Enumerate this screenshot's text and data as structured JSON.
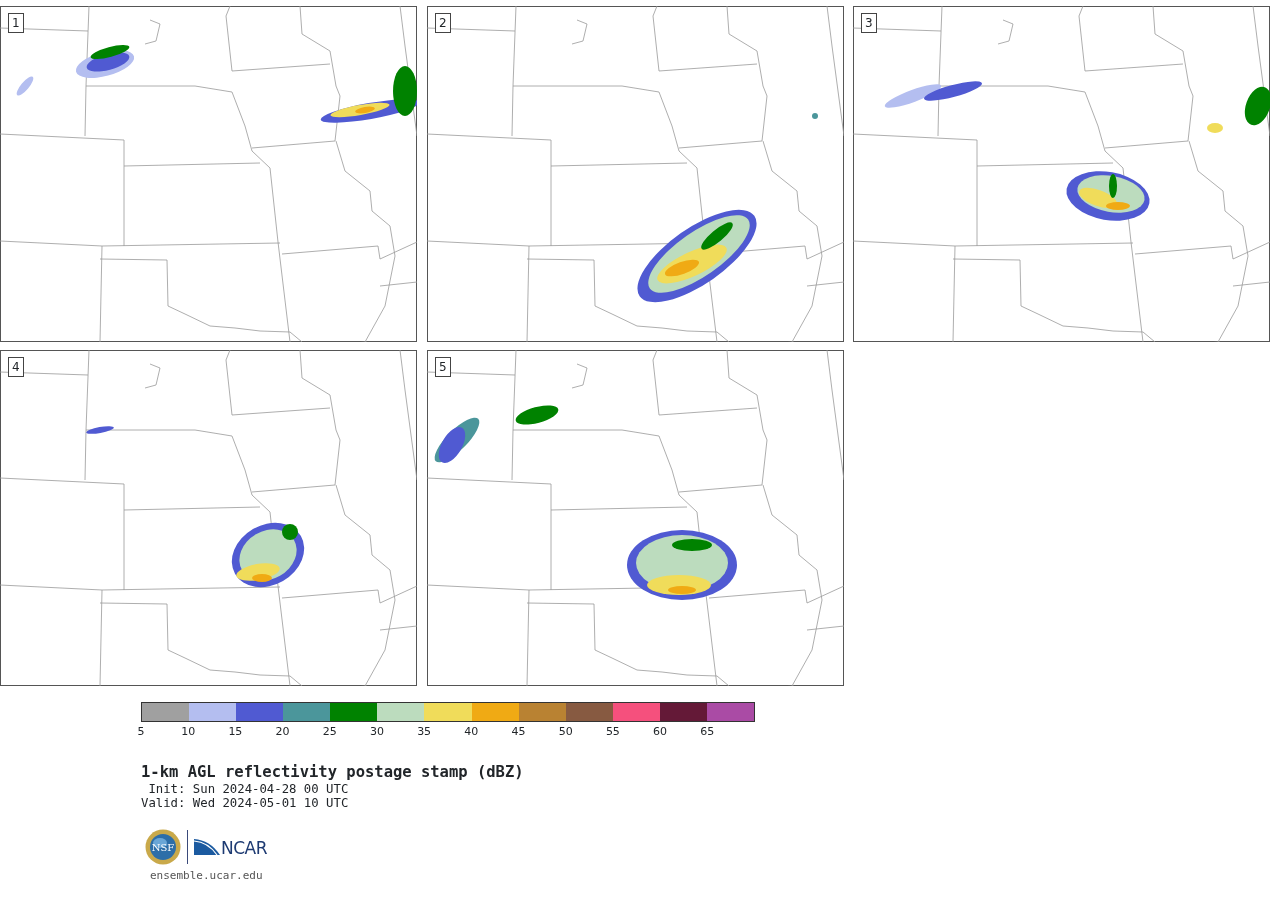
{
  "panels": [
    {
      "label": "1"
    },
    {
      "label": "2"
    },
    {
      "label": "3"
    },
    {
      "label": "4"
    },
    {
      "label": "5"
    }
  ],
  "colorbar": {
    "bins": [
      {
        "color": "#a0a0a0"
      },
      {
        "color": "#b4bef0"
      },
      {
        "color": "#505ad2"
      },
      {
        "color": "#4b969b"
      },
      {
        "color": "#008200"
      },
      {
        "color": "#bcdcbe"
      },
      {
        "color": "#f0dc5a"
      },
      {
        "color": "#f0aa14"
      },
      {
        "color": "#b98232"
      },
      {
        "color": "#875a41"
      },
      {
        "color": "#f5507d"
      },
      {
        "color": "#641937"
      },
      {
        "color": "#aa4ba5"
      }
    ],
    "ticks": [
      "5",
      "10",
      "15",
      "20",
      "25",
      "30",
      "35",
      "40",
      "45",
      "50",
      "55",
      "60",
      "65"
    ]
  },
  "title": "1-km AGL reflectivity postage stamp (dBZ)",
  "init": "Init: Sun 2024-04-28 00 UTC",
  "valid": "Valid: Wed 2024-05-01 10 UTC",
  "logos": {
    "nsf": "NSF",
    "ncar": "NCAR"
  },
  "footer": "ensemble.ucar.edu"
}
